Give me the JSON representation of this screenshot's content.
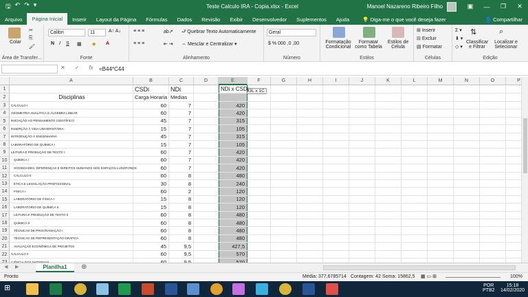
{
  "window": {
    "title": "Teste Calculo IRA - Copia.xlsx  -  Excel",
    "user": "Manoel Nazareno Ribeiro Filho",
    "controls": [
      "—",
      "❐",
      "✕"
    ]
  },
  "tabs": [
    "Arquivo",
    "Página Inicial",
    "Inserir",
    "Layout da Página",
    "Fórmulas",
    "Dados",
    "Revisão",
    "Exibir",
    "Desenvolvedor",
    "Suplementos",
    "Ajuda"
  ],
  "tell_me": "Diga-me o que você deseja fazer",
  "share": "Compartilhar",
  "ribbon": {
    "paste": "Colar",
    "clipboard": "Área de Transfer...",
    "font_name": "Calibri",
    "font_size": "11",
    "font_label": "Fonte",
    "bold": "N",
    "italic": "I",
    "underline": "S",
    "wrap": "Quebrar Texto Automaticamente",
    "merge": "Mesclar e Centralizar",
    "align_label": "Alinhamento",
    "number_format": "Geral",
    "number_label": "Número",
    "cond_format": "Formatação Condicional",
    "format_table": "Formatar como Tabela",
    "cell_styles": "Estilos de Célula",
    "styles_label": "Estilos",
    "insert": "Inserir",
    "delete": "Excluir",
    "format": "Formatar",
    "cells_label": "Células",
    "sort": "Classificar e Filtrar",
    "find": "Localizar e Selecionar",
    "edit_label": "Edição"
  },
  "formula": {
    "fx": "fx",
    "cancel": "✕",
    "confirm": "✓",
    "content": "=B44*C44"
  },
  "columns": [
    "A",
    "B",
    "C",
    "D",
    "E",
    "F",
    "G",
    "H",
    "I",
    "J",
    "K",
    "L",
    "M",
    "N",
    "O",
    "P"
  ],
  "tooltip": "43L x 1C",
  "rows": [
    {
      "n": "1",
      "a": "",
      "b": "CSDi",
      "c": "NDi",
      "e": "NDi x CSDi",
      "hdr": true
    },
    {
      "n": "2",
      "a": "Disciplinas",
      "b": "Carga Horaria",
      "c": "Medias",
      "e": "",
      "hdr": true
    },
    {
      "n": "3",
      "a": "CÁLCULO I",
      "b": "60",
      "c": "7",
      "e": "420"
    },
    {
      "n": "4",
      "a": "GEOMETRIA ANALÍTICA E ÁLGEBRA LINEAR",
      "b": "60",
      "c": "7",
      "e": "420"
    },
    {
      "n": "5",
      "a": "INICIAÇÃO AO PENSAMENTO CIENTÍFICO",
      "b": "45",
      "c": "7",
      "e": "315"
    },
    {
      "n": "6",
      "a": "INSERÇÃO À VIDA UNIVERSITÁRIA",
      "b": "15",
      "c": "7",
      "e": "105"
    },
    {
      "n": "7",
      "a": "INTRODUÇÃO À ENGENHARIA",
      "b": "45",
      "c": "7",
      "e": "315"
    },
    {
      "n": "8",
      "a": "LABORATÓRIO DE QUÍMICA I",
      "b": "15",
      "c": "7",
      "e": "105"
    },
    {
      "n": "9",
      "a": "LEITURA E PRODUÇÃO DE TEXTO I",
      "b": "60",
      "c": "7",
      "e": "420"
    },
    {
      "n": "10",
      "a": "QUÍMICA I",
      "b": "60",
      "c": "7",
      "e": "420"
    },
    {
      "n": "11",
      "a": "SOCIEDADES, DIFERENÇAS E DIREITOS HUMANOS NOS ESPAÇOS LUSÓFONOS",
      "b": "60",
      "c": "7",
      "e": "420"
    },
    {
      "n": "12",
      "a": "CÁLCULO II",
      "b": "60",
      "c": "8",
      "e": "480"
    },
    {
      "n": "13",
      "a": "ÉTICA E LEGISLAÇÃO PROFISSIONAL",
      "b": "30",
      "c": "8",
      "e": "240"
    },
    {
      "n": "14",
      "a": "FÍSICA I",
      "b": "60",
      "c": "2",
      "e": "120"
    },
    {
      "n": "15",
      "a": "LABORATÓRIO DE FÍSICA I",
      "b": "15",
      "c": "8",
      "e": "120"
    },
    {
      "n": "16",
      "a": "LABORATÓRIO DE QUÍMICA II",
      "b": "15",
      "c": "8",
      "e": "120"
    },
    {
      "n": "17",
      "a": "LEITURA E PRODUÇÃO DE TEXTO II",
      "b": "60",
      "c": "8",
      "e": "480"
    },
    {
      "n": "18",
      "a": "QUÍMICA II",
      "b": "60",
      "c": "8",
      "e": "480"
    },
    {
      "n": "19",
      "a": "TÉCNICAS DE PROGRAMAÇÃO I",
      "b": "60",
      "c": "8",
      "e": "480"
    },
    {
      "n": "20",
      "a": "TÉCNICAS DE REPRESENTAÇÃO GRÁFICA",
      "b": "60",
      "c": "8",
      "e": "480"
    },
    {
      "n": "21",
      "a": "AVALIAÇÃO ECONÔMICA DE PROJETOS",
      "b": "45",
      "c": "9,5",
      "e": "427,5"
    },
    {
      "n": "22",
      "a": "CÁLCULO II",
      "b": "60",
      "c": "9,5",
      "e": "570"
    },
    {
      "n": "23",
      "a": "CIÊNCIA DOS MATERIAIS",
      "b": "60",
      "c": "9,5",
      "e": "570"
    }
  ],
  "sheet": {
    "tab": "Planilha1",
    "add": "⊕"
  },
  "status": {
    "ready": "Pronto",
    "average": "Média: 377,6785714",
    "count": "Contagem: 42",
    "sum": "Soma: 15862,5",
    "zoom": "100%"
  },
  "taskbar": {
    "lang": "POR",
    "kbd": "PTB2",
    "time": "15:18",
    "date": "14/02/2020"
  },
  "colors": {
    "excel_green": "#217346",
    "taskbar": "#10263a",
    "selection": "#c6c6c6"
  }
}
